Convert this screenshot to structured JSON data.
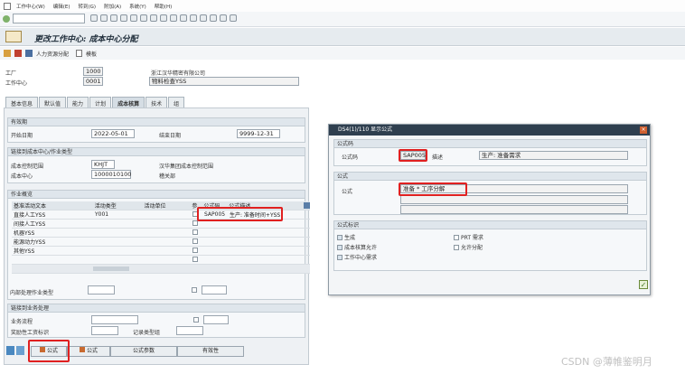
{
  "menubar": {
    "items": [
      "工作中心(W)",
      "编辑(E)",
      "转到(G)",
      "附加(A)",
      "系统(Y)",
      "帮助(H)"
    ]
  },
  "header": {
    "title": "更改工作中心: 成本中心分配"
  },
  "app_toolbar": {
    "capacity_label": "人力资源分配",
    "template_label": "模板"
  },
  "fields": {
    "plant_label": "工厂",
    "plant_value": "1000",
    "plant_desc": "浙江汉华精密有限公司",
    "wc_label": "工作中心",
    "wc_value": "0001",
    "wc_desc": "物料检查YSS"
  },
  "tabs": [
    "基本信息",
    "默认值",
    "能力",
    "计划",
    "成本核算",
    "技术",
    "组"
  ],
  "validity": {
    "header": "有效期",
    "start_label": "开始日期",
    "start_value": "2022-05-01",
    "end_label": "结束日期",
    "end_value": "9999-12-31"
  },
  "cost_link": {
    "header": "链接到成本中心/作业类型",
    "area_label": "成本控制范围",
    "area_value": "KHJT",
    "area_desc": "汉华集团成本控制范围",
    "cc_label": "成本中心",
    "cc_value": "1000010100",
    "cc_desc": "稽关部"
  },
  "activity": {
    "header": "作业概览",
    "columns": [
      "基准活动文本",
      "活动类型",
      "活动单位",
      "参",
      "公式码",
      "公式描述"
    ],
    "rows": [
      {
        "text": "直接人工YSS",
        "type": "Y001",
        "unit": "",
        "formula": "SAP005",
        "desc": "生产: 准备时间+YSS"
      },
      {
        "text": "间接人工YSS",
        "type": "",
        "unit": "",
        "formula": "",
        "desc": ""
      },
      {
        "text": "机器YSS",
        "type": "",
        "unit": "",
        "formula": "",
        "desc": ""
      },
      {
        "text": "能源动力YSS",
        "type": "",
        "unit": "",
        "formula": "",
        "desc": ""
      },
      {
        "text": "其他YSS",
        "type": "",
        "unit": "",
        "formula": "",
        "desc": ""
      },
      {
        "text": "",
        "type": "",
        "unit": "",
        "formula": "",
        "desc": ""
      }
    ],
    "outside_label": "内部处理作业类型"
  },
  "link_business": {
    "header": "链接到业务处理",
    "process_label": "业务流程",
    "qual_label": "奖励性工资标识",
    "record_label": "记录类型组"
  },
  "bottom_buttons": [
    "公式",
    "公式",
    "公式参数",
    "有效性"
  ],
  "dialog": {
    "title": "DS4(1)/110 显示公式",
    "key_header": "公式码",
    "key_label": "公式码",
    "key_value": "SAP005",
    "desc_label": "描述",
    "desc_value": "生产: 准备需求",
    "formula_header": "公式",
    "formula_label": "公式",
    "formula_value": "准备 * 工序分解",
    "flags_header": "公式标识",
    "flags": [
      {
        "label": "生成",
        "checked": true
      },
      {
        "label": "PRT 需求",
        "checked": false
      },
      {
        "label": "成本核算允许",
        "checked": true
      },
      {
        "label": "允许分配",
        "checked": false
      },
      {
        "label": "工作中心需求",
        "checked": true
      }
    ]
  },
  "watermark": "CSDN @薄帷鉴明月",
  "colors": {
    "highlight": "#e02020",
    "dialog_title": "#2f3f4f"
  }
}
